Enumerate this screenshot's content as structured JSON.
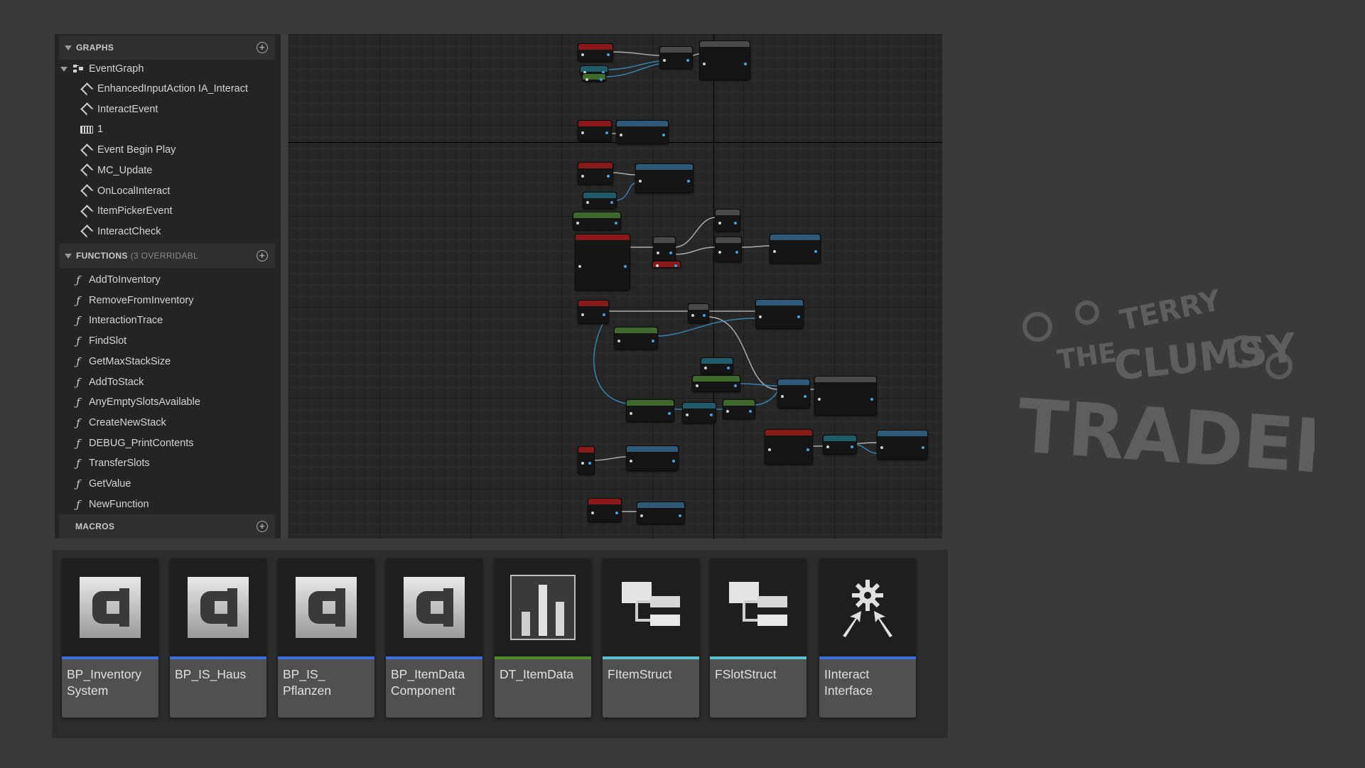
{
  "panel": {
    "graphs_header": "GRAPHS",
    "event_graph": "EventGraph",
    "events": [
      {
        "label": "EnhancedInputAction IA_Interact",
        "icon": "event-icon"
      },
      {
        "label": "InteractEvent",
        "icon": "event-icon"
      },
      {
        "label": "1",
        "icon": "keyboard-icon"
      },
      {
        "label": "Event Begin Play",
        "icon": "event-icon"
      },
      {
        "label": "MC_Update",
        "icon": "event-icon"
      },
      {
        "label": "OnLocalInteract",
        "icon": "event-icon"
      },
      {
        "label": "ItemPickerEvent",
        "icon": "event-icon"
      },
      {
        "label": "InteractCheck",
        "icon": "event-icon"
      }
    ],
    "functions_header": "FUNCTIONS",
    "functions_sub": "(3 OVERRIDABL",
    "functions": [
      "AddToInventory",
      "RemoveFromInventory",
      "InteractionTrace",
      "FindSlot",
      "GetMaxStackSize",
      "AddToStack",
      "AnyEmptySlotsAvailable",
      "CreateNewStack",
      "DEBUG_PrintContents",
      "TransferSlots",
      "GetValue",
      "NewFunction"
    ],
    "macros_header": "MACROS"
  },
  "assets": [
    {
      "name": "BP_Inventory System",
      "line1": "BP_Inventory",
      "line2": "System",
      "kind": "blueprint",
      "icon": "blueprint-class-icon",
      "color": "#3b6fd8"
    },
    {
      "name": "BP_IS_Haus",
      "line1": "BP_IS_Haus",
      "line2": "",
      "kind": "blueprint",
      "icon": "blueprint-class-icon",
      "color": "#3b6fd8"
    },
    {
      "name": "BP_IS_ Pflanzen",
      "line1": "BP_IS_",
      "line2": "Pflanzen",
      "kind": "blueprint",
      "icon": "blueprint-class-icon",
      "color": "#3b6fd8"
    },
    {
      "name": "BP_ItemData Component",
      "line1": "BP_ItemData",
      "line2": "Component",
      "kind": "blueprint",
      "icon": "blueprint-class-icon",
      "color": "#3b6fd8"
    },
    {
      "name": "DT_ItemData",
      "line1": "DT_ItemData",
      "line2": "",
      "kind": "datatable",
      "icon": "data-table-icon",
      "color": "#4f8a2b"
    },
    {
      "name": "FItemStruct",
      "line1": "FItemStruct",
      "line2": "",
      "kind": "struct",
      "icon": "struct-icon",
      "color": "#5cc0d0"
    },
    {
      "name": "FSlotStruct",
      "line1": "FSlotStruct",
      "line2": "",
      "kind": "struct",
      "icon": "struct-icon",
      "color": "#5cc0d0"
    },
    {
      "name": "IInteract Interface",
      "line1": "IInteract",
      "line2": "Interface",
      "kind": "interface",
      "icon": "interface-icon",
      "color": "#3b6fd8"
    }
  ],
  "logo": {
    "text": "TERRY THE CLUMSY TRADER",
    "icon": "terry-the-clumsy-trader-logo"
  }
}
